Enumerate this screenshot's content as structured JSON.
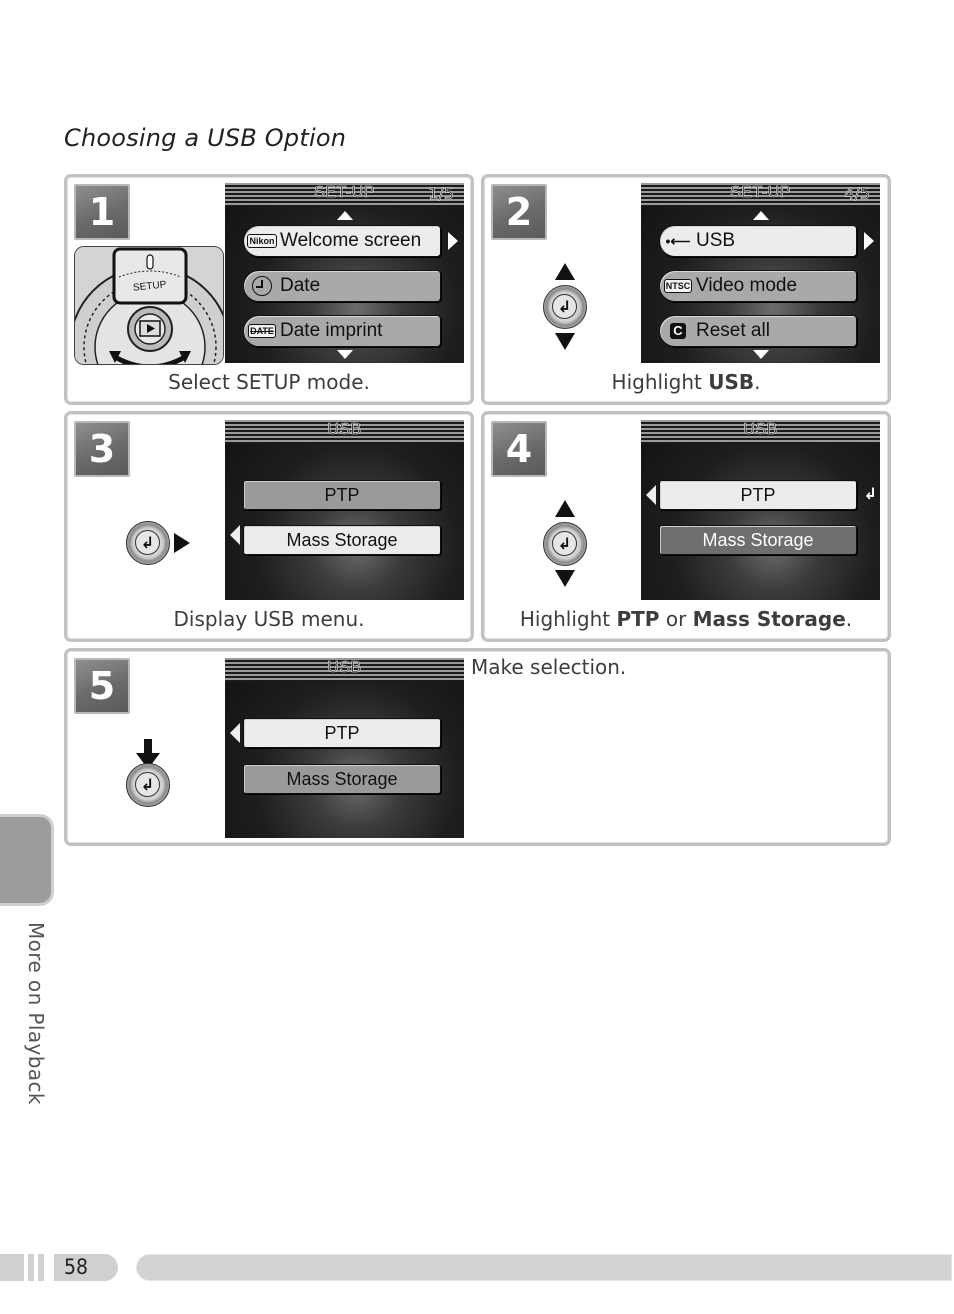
{
  "section_title": "Choosing a USB Option",
  "steps": [
    {
      "number": "1",
      "caption": "Select SETUP mode.",
      "dial_label": "SETUP",
      "screen": {
        "title": "SET-UP",
        "page": "1/5",
        "items": [
          {
            "icon": "nikon-icon",
            "icon_text": "Nikon",
            "label": "Welcome screen",
            "selected": true
          },
          {
            "icon": "clock-icon",
            "icon_text": "",
            "label": "Date",
            "selected": false
          },
          {
            "icon": "date-imprint-icon",
            "icon_text": "DATE",
            "label": "Date imprint",
            "selected": false
          }
        ]
      }
    },
    {
      "number": "2",
      "caption_plain": "Highlight ",
      "caption_bold": "USB",
      "caption_end": ".",
      "screen": {
        "title": "SET-UP",
        "page": "4/5",
        "items": [
          {
            "icon": "usb-icon",
            "icon_text": "•⟵",
            "label": "USB",
            "selected": true
          },
          {
            "icon": "ntsc-icon",
            "icon_text": "NTSC",
            "label": "Video mode",
            "selected": false
          },
          {
            "icon": "reset-icon",
            "icon_text": "C",
            "label": "Reset all",
            "selected": false
          }
        ]
      }
    },
    {
      "number": "3",
      "caption": "Display USB menu.",
      "screen": {
        "title": "USB",
        "options": [
          {
            "label": "PTP",
            "selected": false
          },
          {
            "label": "Mass Storage",
            "selected": true
          }
        ]
      }
    },
    {
      "number": "4",
      "caption_plain": "Highlight ",
      "caption_bold1": "PTP",
      "caption_mid": " or ",
      "caption_bold2": "Mass Storage",
      "caption_end": ".",
      "screen": {
        "title": "USB",
        "options": [
          {
            "label": "PTP",
            "selected": true
          },
          {
            "label": "Mass Storage",
            "selected": false
          }
        ],
        "ok_glyph": "↲"
      }
    },
    {
      "number": "5",
      "caption": "Make selection.",
      "screen": {
        "title": "USB",
        "options": [
          {
            "label": "PTP",
            "selected": true
          },
          {
            "label": "Mass Storage",
            "selected": false
          }
        ]
      }
    }
  ],
  "side_tab_label": "More on Playback",
  "page_number": "58",
  "enter_glyph": "↲"
}
